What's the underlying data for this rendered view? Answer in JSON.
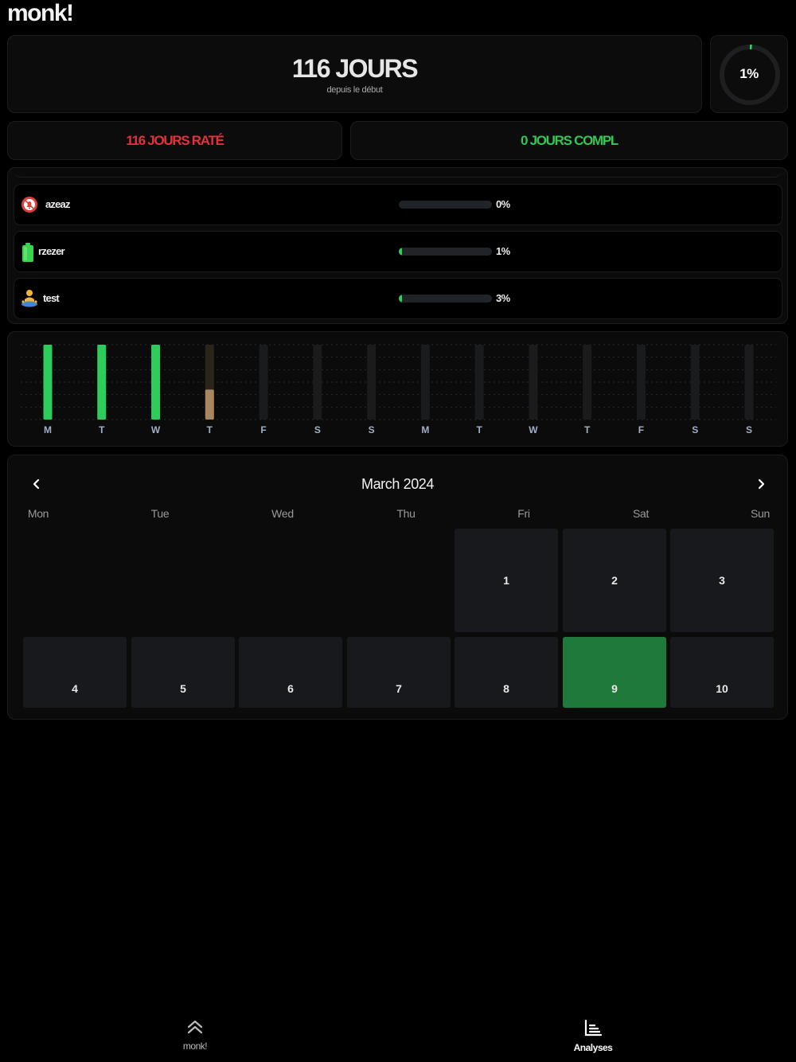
{
  "app": {
    "title": "monk!"
  },
  "summary": {
    "days_value": "116 JOURS",
    "days_sub": "depuis le début",
    "progress_text": "1%",
    "progress_fraction": 0.01,
    "missed_label": "116 JOURS RATÉ",
    "completed_label": "0 JOURS COMPL",
    "missed_color": "#e2323b",
    "completed_color": "#32c753"
  },
  "habits": [
    {
      "name": "azeaz",
      "icon": "no-bell-icon",
      "percent_text": "0%",
      "progress": 0.0
    },
    {
      "name": "rzezer",
      "icon": "battery-icon",
      "percent_text": "1%",
      "progress": 0.01
    },
    {
      "name": "test",
      "icon": "meditation-icon",
      "percent_text": "3%",
      "progress": 0.03
    }
  ],
  "chart_data": {
    "type": "bar",
    "categories": [
      "M",
      "T",
      "W",
      "T",
      "F",
      "S",
      "S",
      "M",
      "T",
      "W",
      "T",
      "F",
      "S",
      "S"
    ],
    "values": [
      1.0,
      1.0,
      1.0,
      0.4,
      0,
      0,
      0,
      0,
      0,
      0,
      0,
      0,
      0,
      0
    ],
    "bar_colors": [
      "#2ecc5a",
      "#2ecc5a",
      "#2ecc5a",
      "#a8865f",
      "#1c1d1f",
      "#1c1d1f",
      "#1c1d1f",
      "#1c1d1f",
      "#1c1d1f",
      "#1c1d1f",
      "#1c1d1f",
      "#1c1d1f",
      "#1c1d1f",
      "#1c1d1f"
    ],
    "ylim": [
      0,
      1
    ],
    "grid": true,
    "title": "",
    "xlabel": "",
    "ylabel": ""
  },
  "calendar": {
    "month_label": "March 2024",
    "prev_icon": "chevron-left-icon",
    "next_icon": "chevron-right-icon",
    "weekdays": [
      "Mon",
      "Tue",
      "Wed",
      "Thu",
      "Fri",
      "Sat",
      "Sun"
    ],
    "days": [
      "1",
      "2",
      "3",
      "4",
      "5",
      "6",
      "7",
      "8",
      "9",
      "10"
    ],
    "completed_day": "9",
    "completed_color": "#1e7a3a"
  },
  "tabbar": {
    "items": [
      {
        "label": "monk!",
        "icon": "double-chevron-up-icon",
        "active": false
      },
      {
        "label": "Analyses",
        "icon": "bar-chart-icon",
        "active": true
      }
    ]
  }
}
